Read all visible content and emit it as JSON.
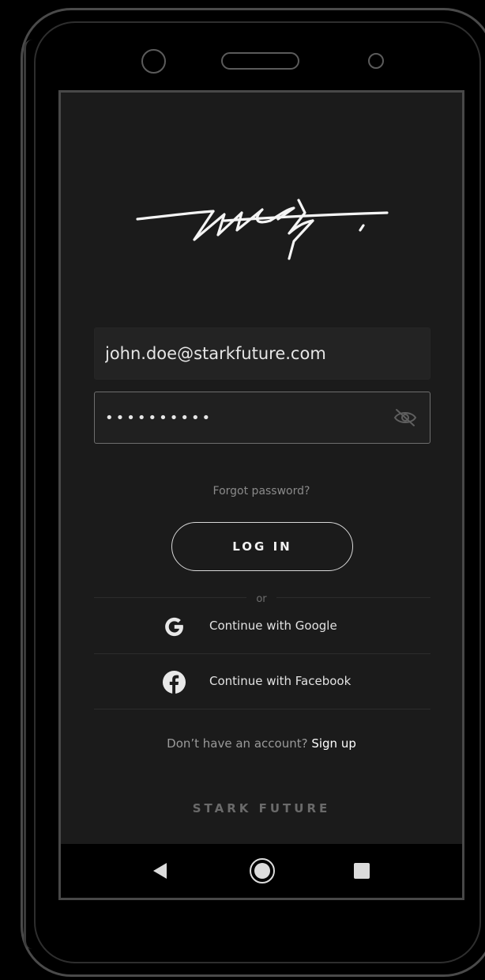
{
  "login": {
    "email_value": "john.doe@starkfuture.com",
    "password_value": "••••••••••",
    "forgot_label": "Forgot password?",
    "login_label": "LOG IN",
    "or_label": "or",
    "google_label": "Continue with Google",
    "facebook_label": "Continue with Facebook",
    "no_account_text": "Don’t have an account?",
    "signup_label": "Sign up",
    "brand_text": "STARK FUTURE"
  },
  "icons": {
    "password_toggle": "eye-off-icon",
    "google": "google-icon",
    "facebook": "facebook-icon",
    "nav_back": "back-triangle-icon",
    "nav_home": "home-circle-icon",
    "nav_recent": "recent-apps-square-icon"
  },
  "colors": {
    "background": "#1b1b1b",
    "field_background": "#232323",
    "text_primary": "#e6e6e6",
    "text_muted": "#8a8a8a",
    "nav_bar": "#000000"
  }
}
